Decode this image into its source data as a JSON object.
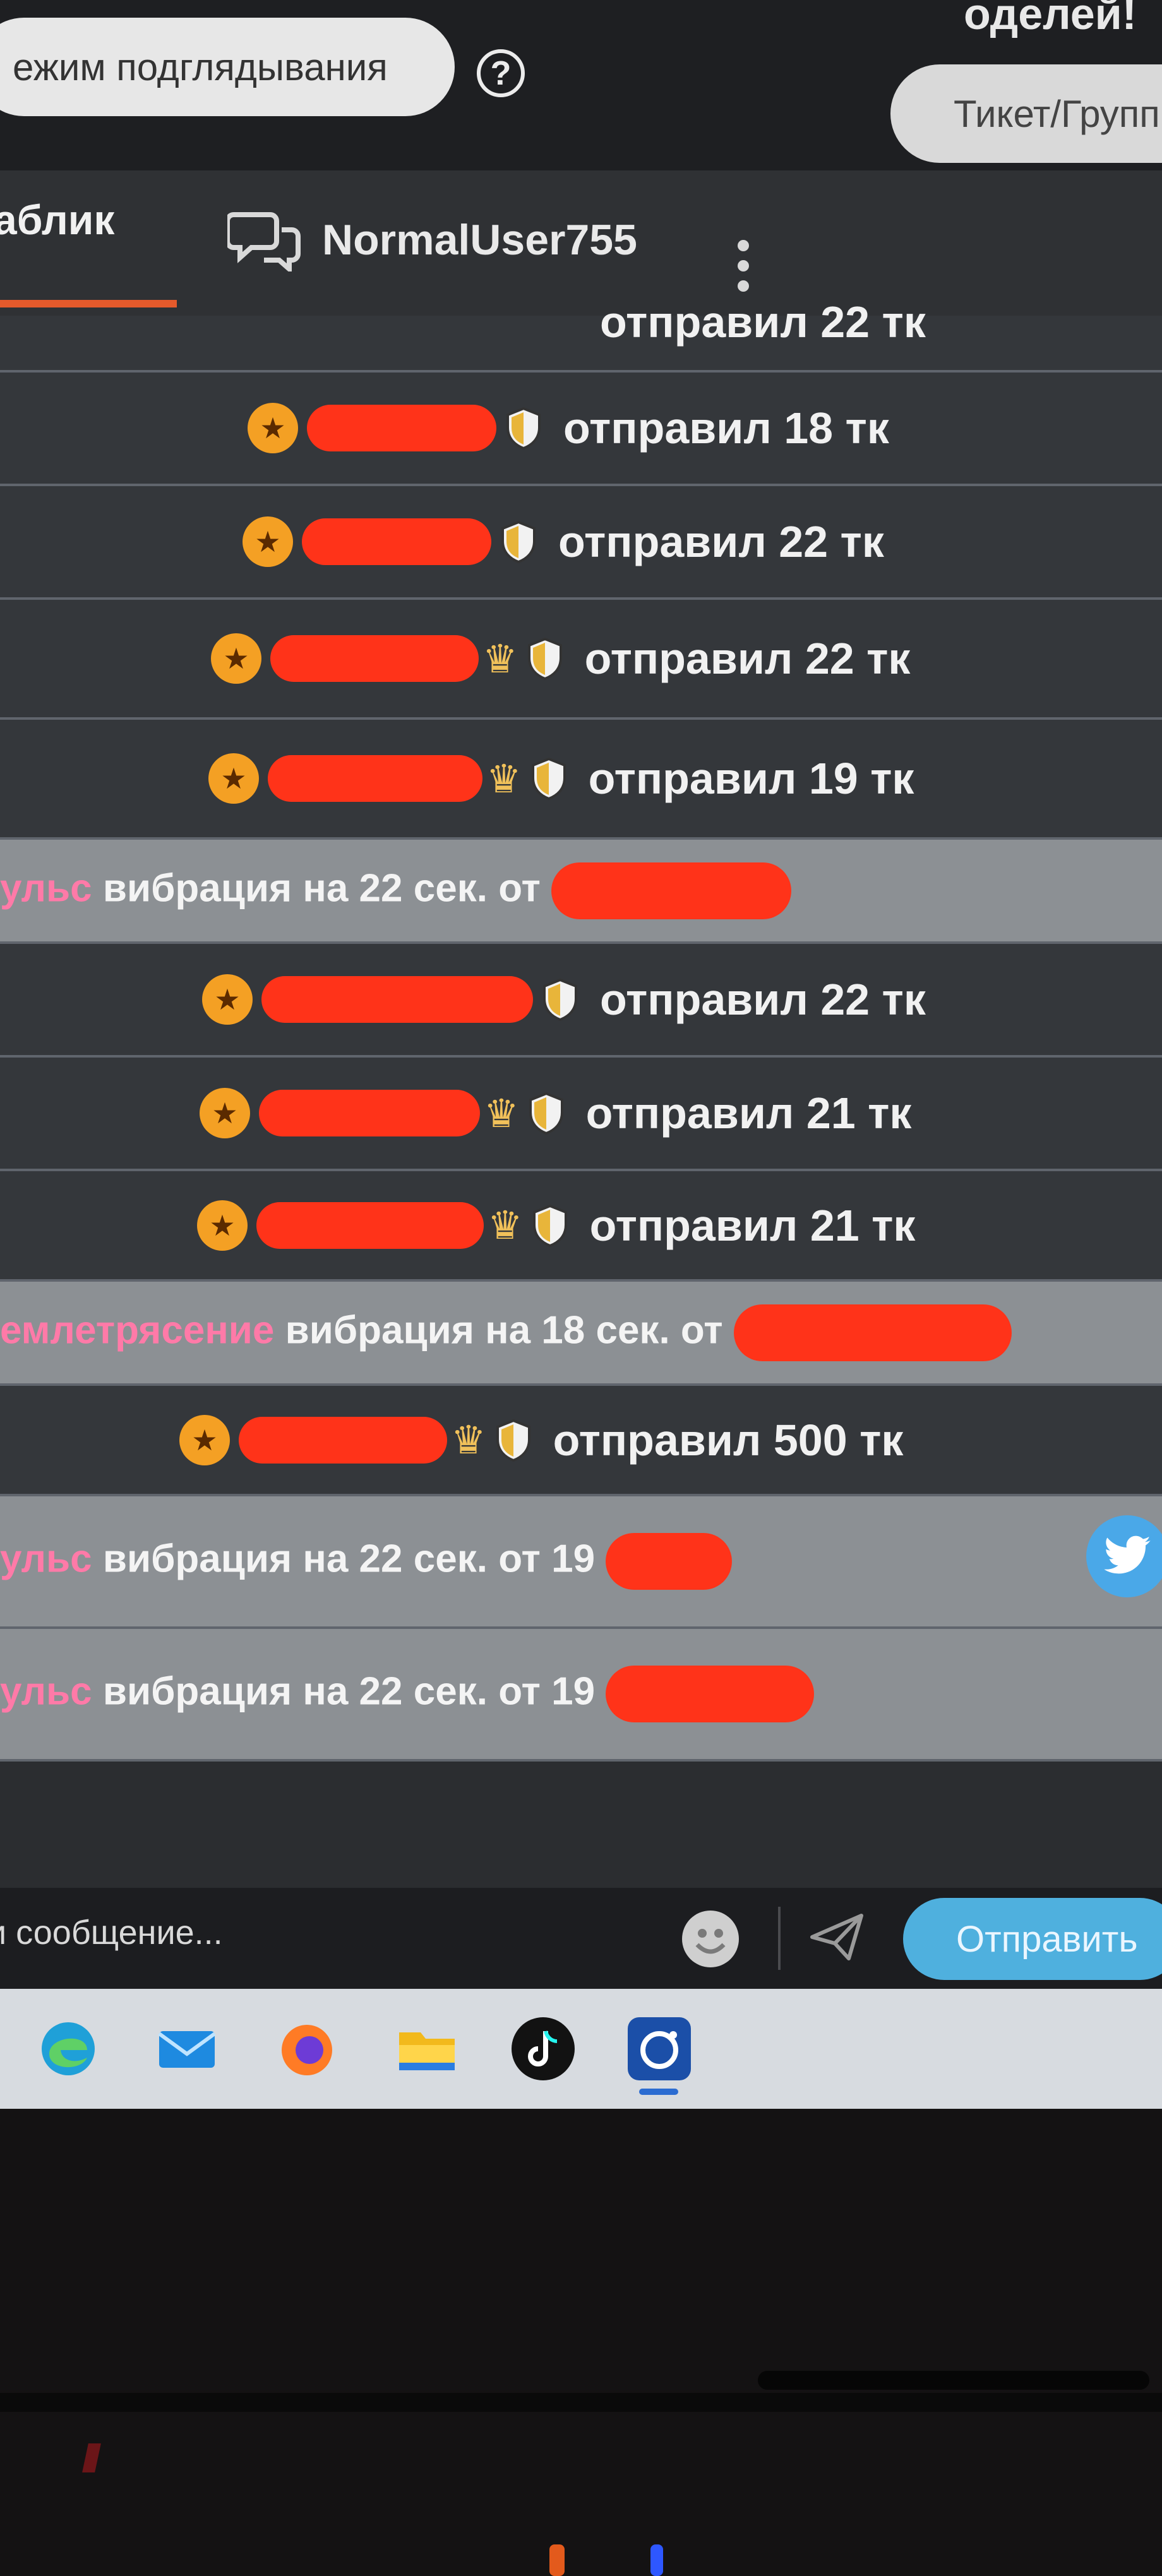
{
  "header": {
    "promo_text": "оделей!",
    "spy_mode_label": "ежим подглядывания",
    "help_glyph": "?",
    "ticket_label": "Тикет/Групп"
  },
  "tabs": {
    "public_label": "аблик",
    "user_label": "NormalUser755"
  },
  "chat": {
    "partial_top": "отправил 22 тк",
    "rows": [
      {
        "type": "tip",
        "text": "отправил 18 тк"
      },
      {
        "type": "tip",
        "text": "отправил 22 тк"
      },
      {
        "type": "tip",
        "text": "отправил 22 тк"
      },
      {
        "type": "tip",
        "text": "отправил 19 тк"
      },
      {
        "type": "vibe",
        "name": "ульс",
        "text": "вибрация на 22 сек. от"
      },
      {
        "type": "tip",
        "text": "отправил 22 тк"
      },
      {
        "type": "tip",
        "text": "отправил 21 тк"
      },
      {
        "type": "tip",
        "text": "отправил 21 тк"
      },
      {
        "type": "vibe",
        "name": "емлетрясение",
        "text": "вибрация на 18 сек. от"
      },
      {
        "type": "tip",
        "text": "отправил 500 тк"
      },
      {
        "type": "vibe",
        "name": "ульс",
        "text": "вибрация на 22 сек. от 19"
      },
      {
        "type": "vibe",
        "name": "ульс",
        "text": "вибрация на 22 сек. от 19"
      }
    ]
  },
  "input": {
    "placeholder": "и сообщение...",
    "send_label": "Отправить"
  },
  "colors": {
    "accent_orange": "#e55a2b",
    "vibe_pink": "#ff7aa8",
    "send_blue": "#4fb0de",
    "star_gold": "#f4a024",
    "redaction_red": "#ff3319"
  },
  "icons": [
    "help-icon",
    "chat-bubbles-icon",
    "kebab-menu-icon",
    "star-badge-icon",
    "crown-icon",
    "shield-icon",
    "twitter-icon",
    "emoji-icon",
    "send-plane-icon",
    "edge-icon",
    "mail-icon",
    "firefox-icon",
    "folder-icon",
    "tiktok-icon",
    "camera-app-icon"
  ]
}
